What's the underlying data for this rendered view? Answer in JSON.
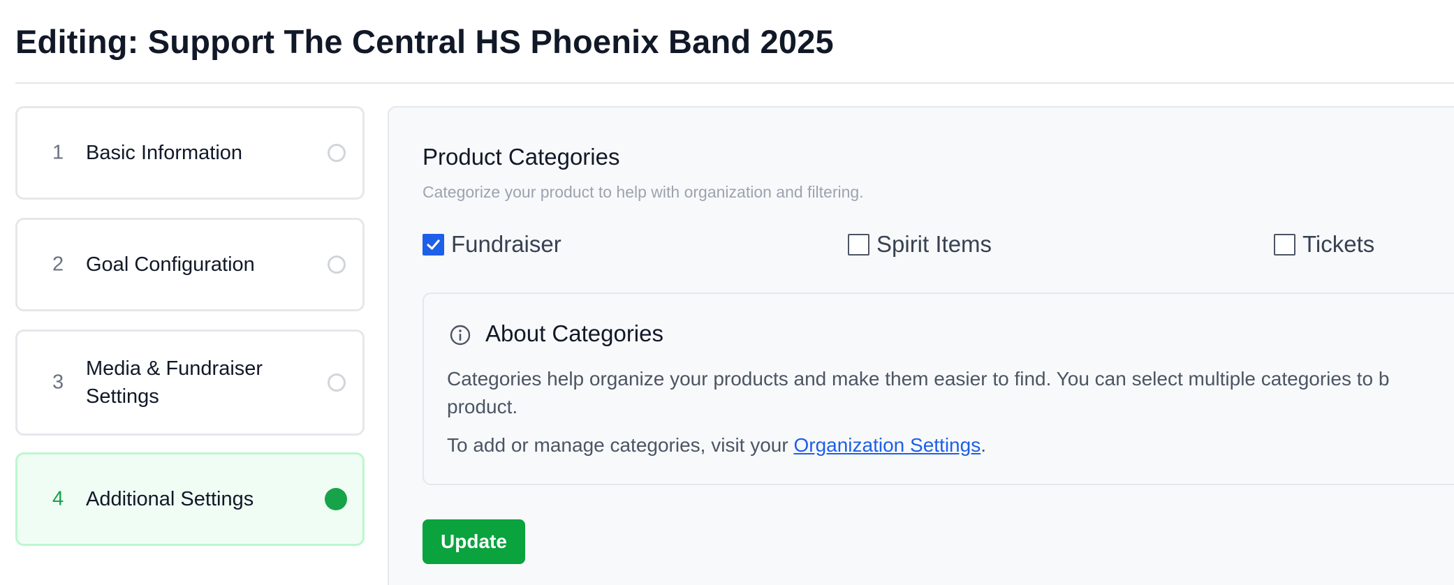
{
  "header": {
    "title": "Editing: Support The Central HS Phoenix Band 2025"
  },
  "steps": [
    {
      "number": "1",
      "label": "Basic Information",
      "status": "incomplete"
    },
    {
      "number": "2",
      "label": "Goal Configuration",
      "status": "incomplete"
    },
    {
      "number": "3",
      "label": "Media & Fundraiser Settings",
      "status": "incomplete"
    },
    {
      "number": "4",
      "label": "Additional Settings",
      "status": "active"
    }
  ],
  "categories_section": {
    "title": "Product Categories",
    "description": "Categorize your product to help with organization and filtering.",
    "options": [
      {
        "label": "Fundraiser",
        "checked": true
      },
      {
        "label": "Spirit Items",
        "checked": false
      },
      {
        "label": "Tickets",
        "checked": false
      }
    ]
  },
  "about": {
    "icon": "info-icon",
    "title": "About Categories",
    "text": "Categories help organize your products and make them easier to find. You can select multiple categories to b",
    "text_wrap": "product.",
    "manage_prefix": "To add or manage categories, visit your ",
    "manage_link": "Organization Settings",
    "manage_suffix": "."
  },
  "actions": {
    "update_label": "Update"
  },
  "colors": {
    "accent_green": "#16a34a",
    "button_green": "#0aa33e",
    "checkbox_blue": "#1d5fe8",
    "link_blue": "#1d5fe8"
  }
}
